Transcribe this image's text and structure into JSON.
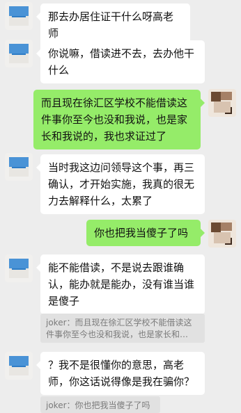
{
  "messages": [
    {
      "side": "in",
      "text": "那去办居住证干什么呀高老师"
    },
    {
      "side": "in",
      "text": "你说嘛，借读进不去，去办他干\n什么"
    },
    {
      "side": "out",
      "text": "而且现在徐汇区学校不能借读这\n件事你至今也没和我说，也是家\n长和我说的，我也求证过了"
    },
    {
      "side": "in",
      "text": "当时我这边问领导这个事，再三\n确认，才开始实施，我真的很无\n力去解释什么，太累了"
    },
    {
      "side": "out",
      "text": "你也把我当傻子了吗"
    },
    {
      "side": "in",
      "text": "能不能借读，不是说去跟谁确\n认，能办就是能办，没有谁当谁\n是傻子"
    },
    {
      "side": "in",
      "text": "？我不是很懂你的意思，高老\n师，你这话说得像是我在骗你？"
    }
  ],
  "quotes": [
    {
      "text": "joker：而且现在徐汇区学校不能借读这\n件事你至今也没和我说，也是家长和…"
    },
    {
      "text": "joker：你也把我当傻子了吗"
    }
  ]
}
